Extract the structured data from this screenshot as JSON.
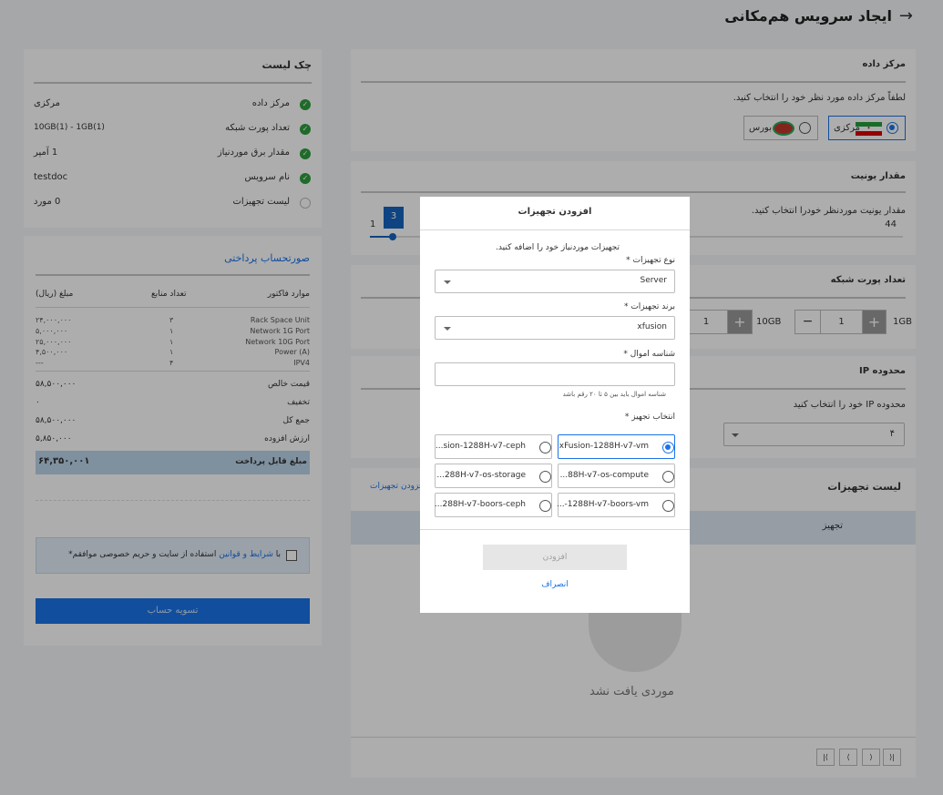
{
  "header": {
    "title": "ایجاد سرویس هم‌مکانی",
    "back_icon": "arrow-right-icon"
  },
  "datacenter": {
    "title": "مرکز داده",
    "hint": "لطفاً مرکز داده مورد نظر خود را انتخاب کنید.",
    "options": [
      {
        "label": "مرکزی",
        "icon": "iran-flag-icon",
        "selected": true
      },
      {
        "label": "بورس",
        "icon": "bourse-logo-icon",
        "selected": false
      }
    ]
  },
  "unit": {
    "title": "مقدار یونیت",
    "hint": "مقدار یونیت موردنظر خودرا انتخاب کنید.",
    "max": "44",
    "min": "1",
    "value": "3"
  },
  "ports": {
    "title": "تعداد پورت شبکه",
    "items": [
      {
        "label": "1GB",
        "value": "1",
        "plus": "+",
        "minus": "−"
      },
      {
        "label": "10GB",
        "value": "1",
        "plus": "+"
      }
    ]
  },
  "ip": {
    "title": "محدوده IP",
    "hint": "محدوده IP خود را انتخاب کنید",
    "value": "۴"
  },
  "equipment_list": {
    "title": "لیست تجهیزات",
    "add_link": "افزودن تجهیزات",
    "column": "تجهیز",
    "empty": "موردی یافت نشد",
    "pager": [
      "⟩|",
      "⟩",
      "⟨",
      "|⟨"
    ]
  },
  "checklist": {
    "title": "چک لیست",
    "items": [
      {
        "label": "مرکز داده",
        "value": "مرکزی",
        "done": true
      },
      {
        "label": "تعداد پورت شبکه",
        "value": "10GB(1) - 1GB(1)",
        "done": true
      },
      {
        "label": "مقدار برق موردنیاز",
        "value": "1 آمپر",
        "done": true
      },
      {
        "label": "نام سرویس",
        "value": "testdoc",
        "done": true
      },
      {
        "label": "لیست تجهیزات",
        "value": "0 مورد",
        "done": false
      }
    ]
  },
  "invoice": {
    "title": "صورتحساب پرداختی",
    "columns": [
      "موارد فاکتور",
      "تعداد منابع",
      "مبلغ (ریال)"
    ],
    "rows": [
      {
        "item": "Rack Space Unit",
        "count": "۳",
        "price": "۲۴,۰۰۰,۰۰۰"
      },
      {
        "item": "Network 1G Port",
        "count": "۱",
        "price": "۵,۰۰۰,۰۰۰"
      },
      {
        "item": "Network 10G Port",
        "count": "۱",
        "price": "۲۵,۰۰۰,۰۰۰"
      },
      {
        "item": "Power (A)",
        "count": "۱",
        "price": "۴,۵۰۰,۰۰۰"
      },
      {
        "item": "IPV4",
        "count": "۴",
        "price": "---"
      }
    ],
    "totals": [
      {
        "label": "قیمت خالص",
        "value": "۵۸,۵۰۰,۰۰۰"
      },
      {
        "label": "تخفیف",
        "value": "۰"
      },
      {
        "label": "جمع کل",
        "value": "۵۸,۵۰۰,۰۰۰"
      },
      {
        "label": "ارزش افزوده",
        "value": "۵,۸۵۰,۰۰۰"
      }
    ],
    "payable_label": "مبلغ قابل پرداخت",
    "payable_value": "۶۴,۳۵۰,۰۰۱",
    "terms_prefix": "با",
    "terms_link": "شرایط و قوانین",
    "terms_suffix": "استفاده از سایت و حریم خصوصی موافقم*",
    "pay_button": "تسویه حساب"
  },
  "modal": {
    "title": "افزودن تجهیزات",
    "hint": "تجهیزات موردنیاز خود را اضافه کنید.",
    "type_label": "نوع تجهیزات *",
    "type_value": "Server",
    "brand_label": "برند تجهیزات *",
    "brand_value": "xfusion",
    "asset_label": "شناسه اموال *",
    "asset_value": "",
    "asset_help": "شناسه اموال باید بین ۵ تا ۲۰ رقم باشد",
    "device_label": "انتخاب تجهیز *",
    "devices": [
      {
        "label": "xFusion-1288H-v7-vm",
        "selected": true
      },
      {
        "label": "...sion-1288H-v7-ceph",
        "selected": false
      },
      {
        "label": "...88H-v7-os-compute",
        "selected": false
      },
      {
        "label": "...288H-v7-os-storage",
        "selected": false
      },
      {
        "label": "...-1288H-v7-boors-vm",
        "selected": false
      },
      {
        "label": "...288H-v7-boors-ceph",
        "selected": false
      }
    ],
    "add_button": "افزودن",
    "cancel_button": "انصراف"
  },
  "colors": {
    "primary": "#1a73e8",
    "success": "#2e9e3e",
    "payable_bg": "#bcd4ea",
    "terms_bg": "#e4eef8",
    "slider_badge": "#1565c0"
  }
}
